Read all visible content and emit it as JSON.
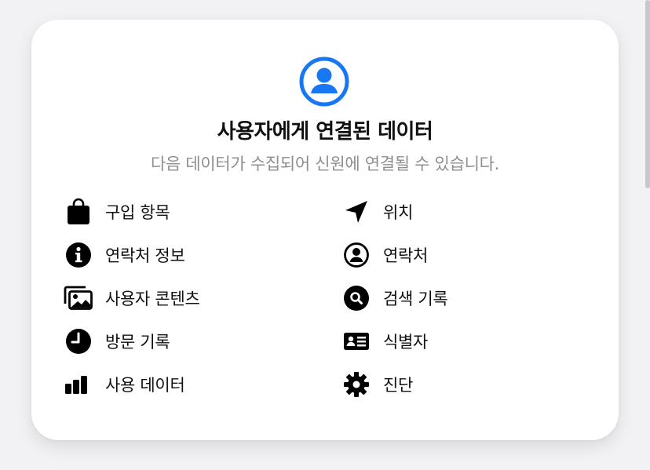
{
  "header": {
    "icon": "person-circle-icon",
    "accent_color": "#1877f2",
    "title": "사용자에게 연결된 데이터",
    "subtitle": "다음 데이터가 수집되어 신원에 연결될 수 있습니다."
  },
  "items": [
    {
      "icon": "shopping-bag-icon",
      "label": "구입 항목"
    },
    {
      "icon": "location-arrow-icon",
      "label": "위치"
    },
    {
      "icon": "info-circle-icon",
      "label": "연락처 정보"
    },
    {
      "icon": "person-circle-outline-icon",
      "label": "연락처"
    },
    {
      "icon": "photos-icon",
      "label": "사용자 콘텐츠"
    },
    {
      "icon": "search-circle-icon",
      "label": "검색 기록"
    },
    {
      "icon": "clock-icon",
      "label": "방문 기록"
    },
    {
      "icon": "id-card-icon",
      "label": "식별자"
    },
    {
      "icon": "bar-chart-icon",
      "label": "사용 데이터"
    },
    {
      "icon": "gear-icon",
      "label": "진단"
    }
  ]
}
